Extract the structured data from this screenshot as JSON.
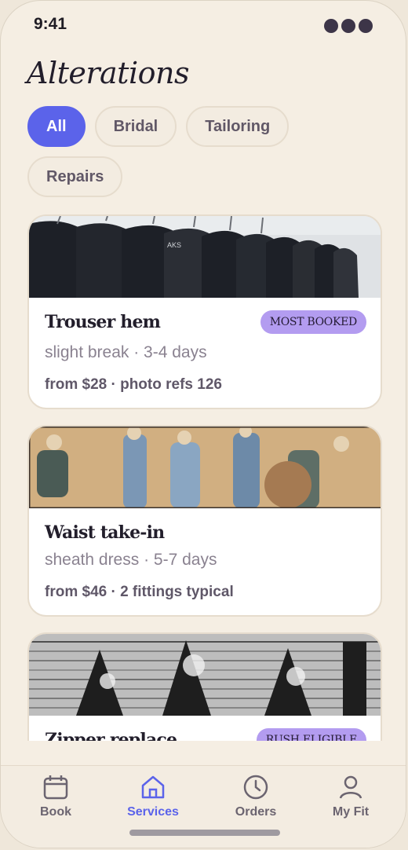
{
  "status": {
    "time": "9:41"
  },
  "header": {
    "title": "Alterations"
  },
  "filters": [
    {
      "label": "All",
      "active": true
    },
    {
      "label": "Bridal",
      "active": false
    },
    {
      "label": "Tailoring",
      "active": false
    },
    {
      "label": "Repairs",
      "active": false
    }
  ],
  "cards": [
    {
      "title": "Trouser hem",
      "badge": "MOST BOOKED",
      "subtitle": "slight break · 3-4 days",
      "meta": "from $28 · photo refs 126"
    },
    {
      "title": "Waist take-in",
      "badge": "",
      "subtitle": "sheath dress · 5-7 days",
      "meta": "from $46 · 2 fittings typical"
    },
    {
      "title": "Zipper replace",
      "badge": "RUSH ELIGIBLE",
      "subtitle": "",
      "meta": ""
    }
  ],
  "tabs": [
    {
      "label": "Book",
      "icon": "calendar-icon"
    },
    {
      "label": "Services",
      "icon": "home-icon"
    },
    {
      "label": "Orders",
      "icon": "clock-icon"
    },
    {
      "label": "My Fit",
      "icon": "person-icon"
    }
  ],
  "colors": {
    "accent": "#5b63ea",
    "badge": "#b39cf0",
    "background": "#f5eee3"
  }
}
